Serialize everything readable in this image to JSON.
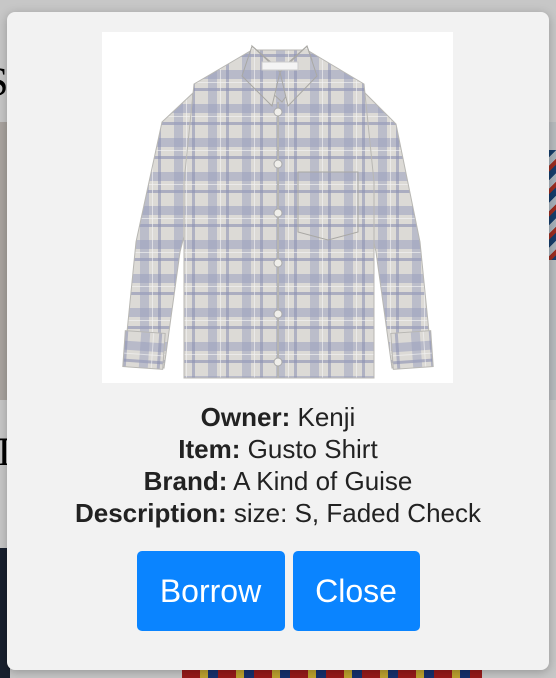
{
  "background": {
    "heading_fragment": "S",
    "heading_fragment2": "T"
  },
  "modal": {
    "image": {
      "subject": "plaid long-sleeve shirt",
      "icon": "shirt-image"
    },
    "details": {
      "owner_label": "Owner:",
      "owner_value": "Kenji",
      "item_label": "Item:",
      "item_value": "Gusto Shirt",
      "brand_label": "Brand:",
      "brand_value": "A Kind of Guise",
      "description_label": "Description:",
      "description_value": "size: S, Faded Check"
    },
    "actions": {
      "borrow_label": "Borrow",
      "close_label": "Close"
    }
  },
  "colors": {
    "button": "#0a84ff",
    "modal_bg": "#f2f2f2",
    "shirt_base": "#d8d6d2",
    "shirt_check": "#8f95b4"
  }
}
